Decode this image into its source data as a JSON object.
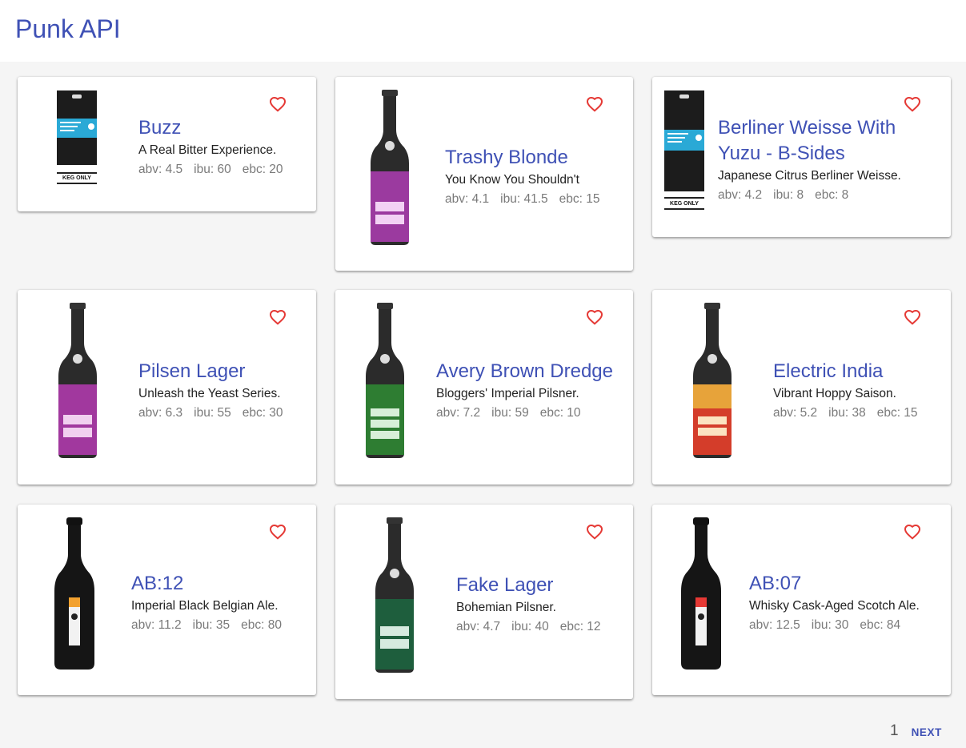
{
  "app": {
    "title": "Punk API"
  },
  "colors": {
    "accent": "#3f51b5",
    "favorite": "#e53935",
    "background": "#f5f5f5"
  },
  "beers": [
    {
      "name": "Buzz",
      "tagline": "A Real Bitter Experience.",
      "abv": "abv: 4.5",
      "ibu": "ibu: 60",
      "ebc": "ebc: 20",
      "image": "keg-only-label",
      "label_text": "KEG ONLY"
    },
    {
      "name": "Trashy Blonde",
      "tagline": "You Know You Shouldn't",
      "abv": "abv: 4.1",
      "ibu": "ibu: 41.5",
      "ebc": "ebc: 15",
      "image": "beer-bottle"
    },
    {
      "name": "Berliner Weisse With Yuzu - B-Sides",
      "name_lines": [
        "Berliner Weisse With",
        "Yuzu - B-Sides"
      ],
      "tagline": "Japanese Citrus Berliner Weisse.",
      "abv": "abv: 4.2",
      "ibu": "ibu: 8",
      "ebc": "ebc: 8",
      "image": "keg-only-label",
      "label_text": "KEG ONLY"
    },
    {
      "name": "Pilsen Lager",
      "tagline": "Unleash the Yeast Series.",
      "abv": "abv: 6.3",
      "ibu": "ibu: 55",
      "ebc": "ebc: 30",
      "image": "beer-bottle"
    },
    {
      "name": "Avery Brown Dredge",
      "tagline": "Bloggers' Imperial Pilsner.",
      "abv": "abv: 7.2",
      "ibu": "ibu: 59",
      "ebc": "ebc: 10",
      "image": "beer-bottle"
    },
    {
      "name": "Electric India",
      "tagline": "Vibrant Hoppy Saison.",
      "abv": "abv: 5.2",
      "ibu": "ibu: 38",
      "ebc": "ebc: 15",
      "image": "beer-bottle"
    },
    {
      "name": "AB:12",
      "tagline": "Imperial Black Belgian Ale.",
      "abv": "abv: 11.2",
      "ibu": "ibu: 35",
      "ebc": "ebc: 80",
      "image": "black-bottle"
    },
    {
      "name": "Fake Lager",
      "tagline": "Bohemian Pilsner.",
      "abv": "abv: 4.7",
      "ibu": "ibu: 40",
      "ebc": "ebc: 12",
      "image": "beer-bottle"
    },
    {
      "name": "AB:07",
      "tagline": "Whisky Cask-Aged Scotch Ale.",
      "abv": "abv: 12.5",
      "ibu": "ibu: 30",
      "ebc": "ebc: 84",
      "image": "black-bottle"
    }
  ],
  "pagination": {
    "current_page": "1",
    "next_label": "NEXT"
  }
}
